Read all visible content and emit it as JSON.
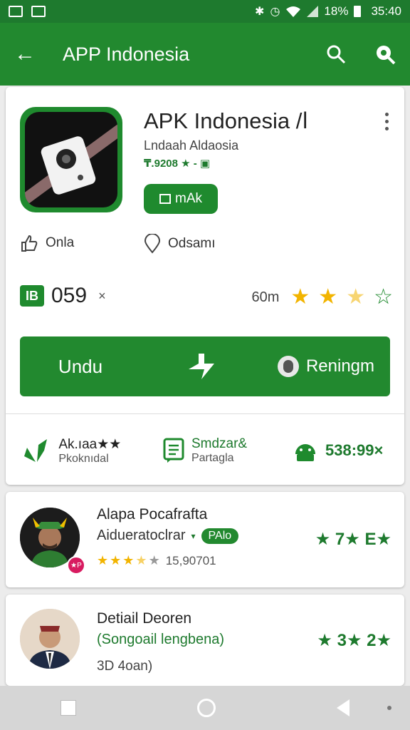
{
  "status_bar": {
    "battery": "18%",
    "time": "35:40"
  },
  "app_bar": {
    "title": "APP Indonesia"
  },
  "app": {
    "title": "APK Indonesia /ا",
    "developer": "Lndaah Aldaosia",
    "meta": "₸.9208 ★ - ▣",
    "badge_label": "mAk",
    "feature_left": "Onla",
    "feature_right": "Odsamı",
    "stat_icon_text": "IB",
    "stat_number": "059",
    "stat_suffix": "×",
    "size_text": "60m",
    "rating_value": 2.5,
    "rating_max": 4
  },
  "action_bar": {
    "download_label": "Undu",
    "center_icon": "plus-arrow-icon",
    "right_label": "Reningm"
  },
  "info_row": {
    "cell1_title": "Ak.ıaa★★",
    "cell1_sub": "Pkoknıdal",
    "cell2_title": "Smdzar&",
    "cell2_sub": "Partagla",
    "cell3_value": "538:99×"
  },
  "reviews": [
    {
      "name": "Alapa Pocafrafta",
      "subtitle": "Aidueratoclrar",
      "tag": "PAlo",
      "avatar_badge": "★P",
      "stars_filled": 3.5,
      "stars_total": 5,
      "count": "15,90701",
      "right_rating": "★ 7★ E★"
    },
    {
      "name": "Detiail Deoren",
      "subtitle_green": "(Songoail lengbena)",
      "footer": "3D 4oan)",
      "right_rating": "★ 3★ 2★"
    }
  ],
  "colors": {
    "brand": "#22892f",
    "brand_dark": "#1e7a2e",
    "star": "#f2b400"
  }
}
